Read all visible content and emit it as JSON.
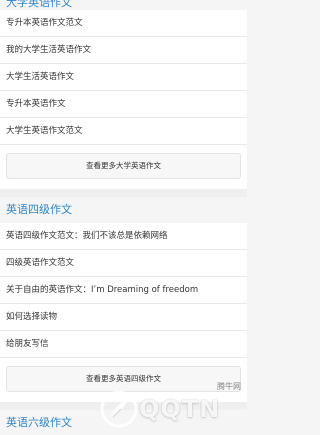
{
  "sections": [
    {
      "title": "大学英语作文",
      "items": [
        "专升本英语作文范文",
        "我的大学生活英语作文",
        "大学生活英语作文",
        "专升本英语作文",
        "大学生英语作文范文"
      ],
      "more_label": "查看更多大学英语作文"
    },
    {
      "title": "英语四级作文",
      "items": [
        "英语四级作文范文：我们不该总是依赖网络",
        "四级英语作文范文",
        "关于自由的英语作文：I’m Dreaming of freedom",
        "如何选择读物",
        "给朋友写信"
      ],
      "more_label": "查看更多英语四级作文"
    },
    {
      "title": "英语六级作文"
    }
  ],
  "watermark": {
    "brand": "QQTN",
    "small_text": "腾牛网",
    "icon": "feather-logo-icon"
  }
}
